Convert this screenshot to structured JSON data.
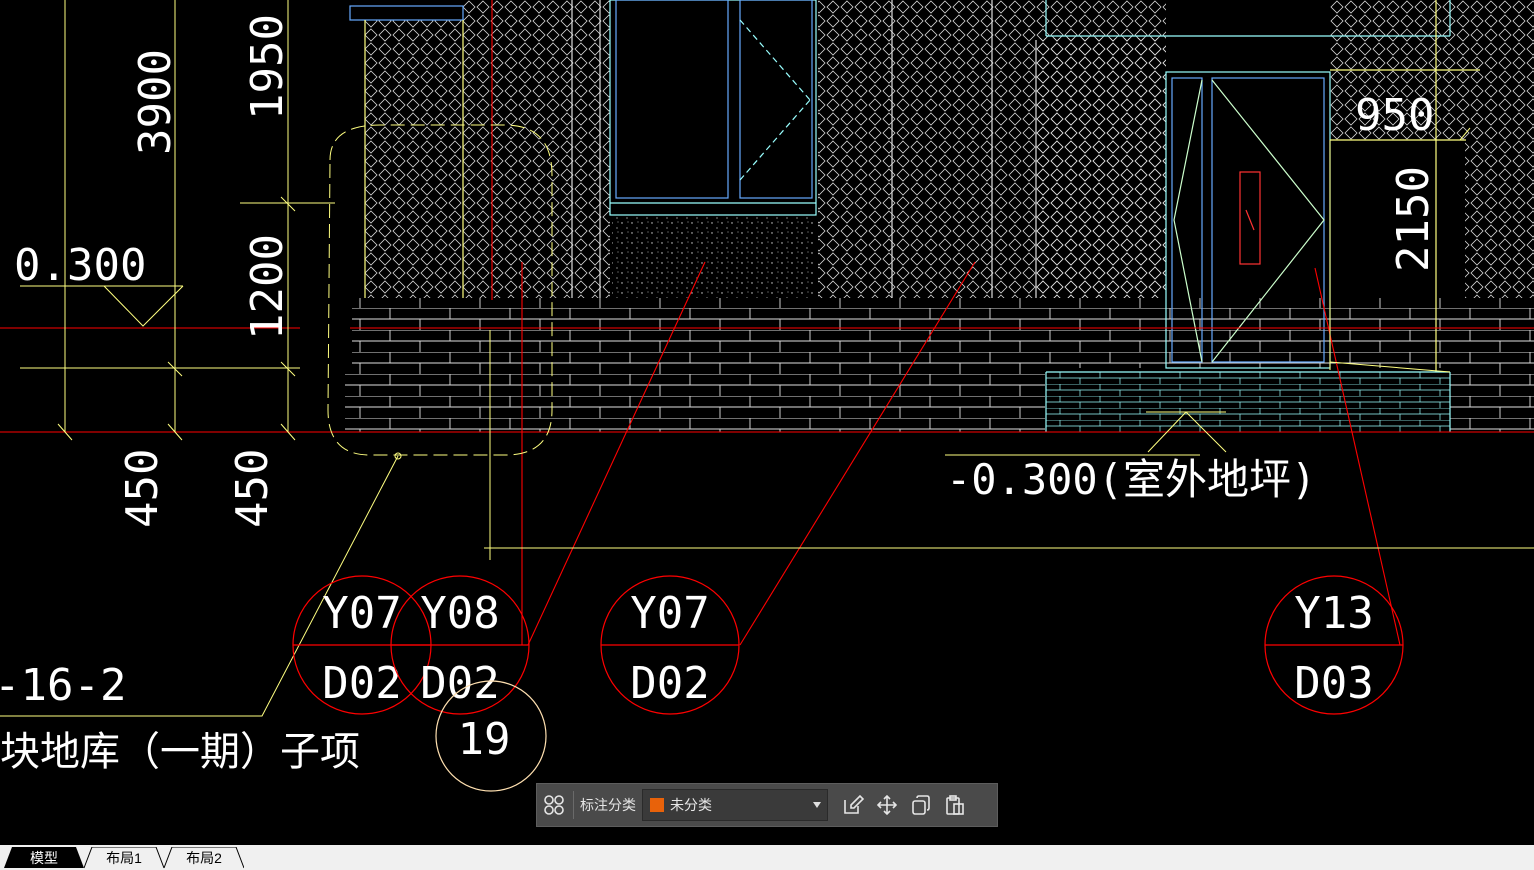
{
  "drawing": {
    "dimensions": {
      "dim_3900": "3900",
      "dim_1950": "1950",
      "dim_1200": "1200",
      "dim_450a": "450",
      "dim_450b": "450",
      "dim_950": "950",
      "dim_2150": "2150"
    },
    "elevations": {
      "elev_left": "0.300",
      "elev_right": "-0.300(室外地坪)"
    },
    "callouts": [
      {
        "top": "Y07",
        "bottom": "D02"
      },
      {
        "top": "Y08",
        "bottom": "D02"
      },
      {
        "top": "Y07",
        "bottom": "D02"
      },
      {
        "top": "Y13",
        "bottom": "D03"
      }
    ],
    "circle_label": "19",
    "note_code": "-16-2",
    "note_title": "块地库（一期）子项"
  },
  "toolbar": {
    "label": "标注分类",
    "selected": "未分类",
    "swatch_color": "#e8620a",
    "icons": [
      "grid-icon",
      "edit-icon",
      "move-icon",
      "copy-icon",
      "paste-icon"
    ]
  },
  "tabs": [
    "模型",
    "布局1",
    "布局2"
  ],
  "colors": {
    "background": "#000000",
    "red": "#ff0000",
    "yellow": "#ffff80",
    "cyan": "#00ffff",
    "blue": "#4080ff",
    "white": "#ffffff"
  }
}
